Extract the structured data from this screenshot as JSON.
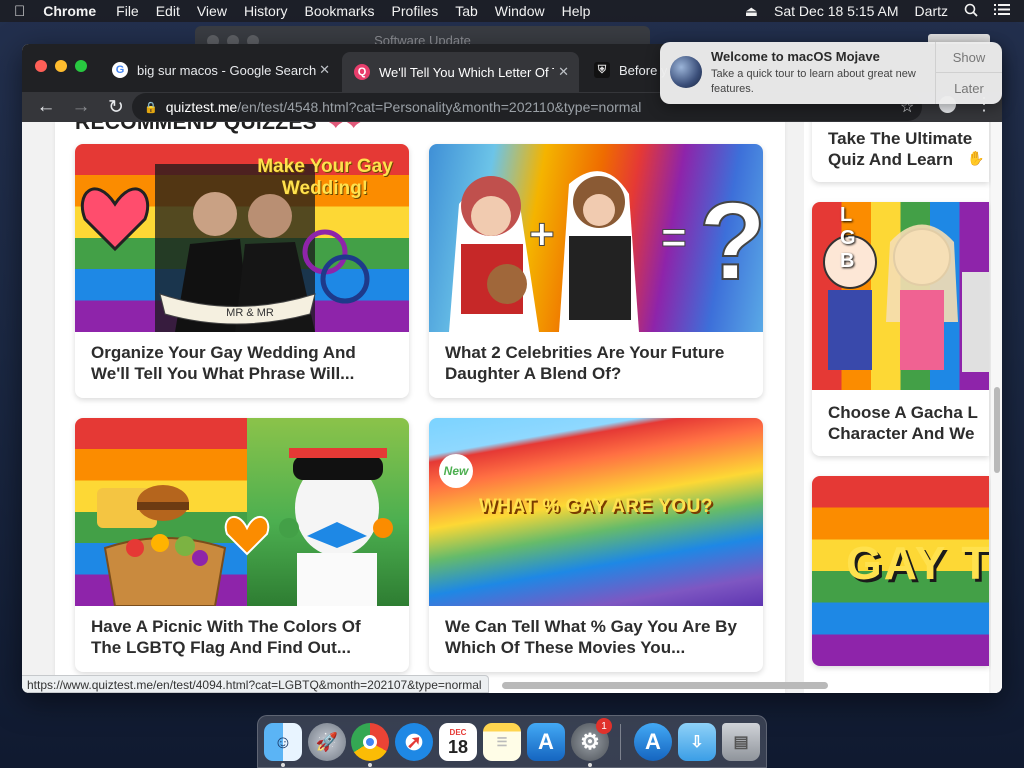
{
  "menubar": {
    "app_name": "Chrome",
    "menus": [
      "File",
      "Edit",
      "View",
      "History",
      "Bookmarks",
      "Profiles",
      "Tab",
      "Window",
      "Help"
    ],
    "clock": "Sat Dec 18  5:15 AM",
    "user": "Dartz",
    "icons": [
      "apple-icon",
      "eject-icon",
      "spotlight-search-icon",
      "control-strip-icon"
    ]
  },
  "background_window": {
    "title": "Software Update"
  },
  "notification": {
    "title": "Welcome to macOS Mojave",
    "body": "Take a quick tour to learn about great new features.",
    "show_label": "Show",
    "later_label": "Later"
  },
  "browser": {
    "tabs": [
      {
        "title": "big sur macos - Google Search",
        "favicon": "google-icon",
        "active": false
      },
      {
        "title": "We'll Tell You Which Letter Of T",
        "favicon": "quiztest-icon",
        "active": true
      },
      {
        "title": "Before y",
        "favicon": "shield-icon",
        "active": false
      }
    ],
    "url_host": "quiztest.me",
    "url_path": "/en/test/4548.html?cat=Personality&month=202110&type=normal",
    "status_url": "https://www.quiztest.me/en/test/4094.html?cat=LGBTQ&month=202107&type=normal"
  },
  "page": {
    "section_heading": "RECOMMEND QUIZZES",
    "cards": [
      {
        "title": "Organize Your Gay Wedding And We'll Tell You What Phrase Will...",
        "image_text": "Make Your Gay Wedding!",
        "banner_text": "MR & MR"
      },
      {
        "title": "What 2 Celebrities Are Your Future Daughter A Blend Of?",
        "image_text": "+ ="
      },
      {
        "title": "Have A Picnic With The Colors Of The LGBTQ Flag And Find Out...",
        "image_text": ""
      },
      {
        "title": "We Can Tell What % Gay You Are By Which Of These Movies You...",
        "image_text": "WHAT % GAY ARE YOU?",
        "badge": "New"
      }
    ],
    "sidebar_cards": [
      {
        "title_line1": "Take The Ultimate",
        "title_line2": "Quiz And Learn"
      },
      {
        "title_line1": "Choose A Gacha L",
        "title_line2": "Character And We",
        "image_text": "L G B"
      },
      {
        "image_text": "GAY TE"
      }
    ]
  },
  "dock": {
    "apps": [
      "Finder",
      "Launchpad",
      "Google Chrome",
      "Safari",
      "Calendar",
      "Notes",
      "App Store",
      "System Preferences",
      "Downloads",
      "Applications",
      "Trash"
    ],
    "calendar_month": "DEC",
    "calendar_day": "18",
    "prefs_badge": "1"
  },
  "colors": {
    "accent": "#1a73e8",
    "menubar_bg": "#1c1e26",
    "tab_active_bg": "#35363a"
  }
}
